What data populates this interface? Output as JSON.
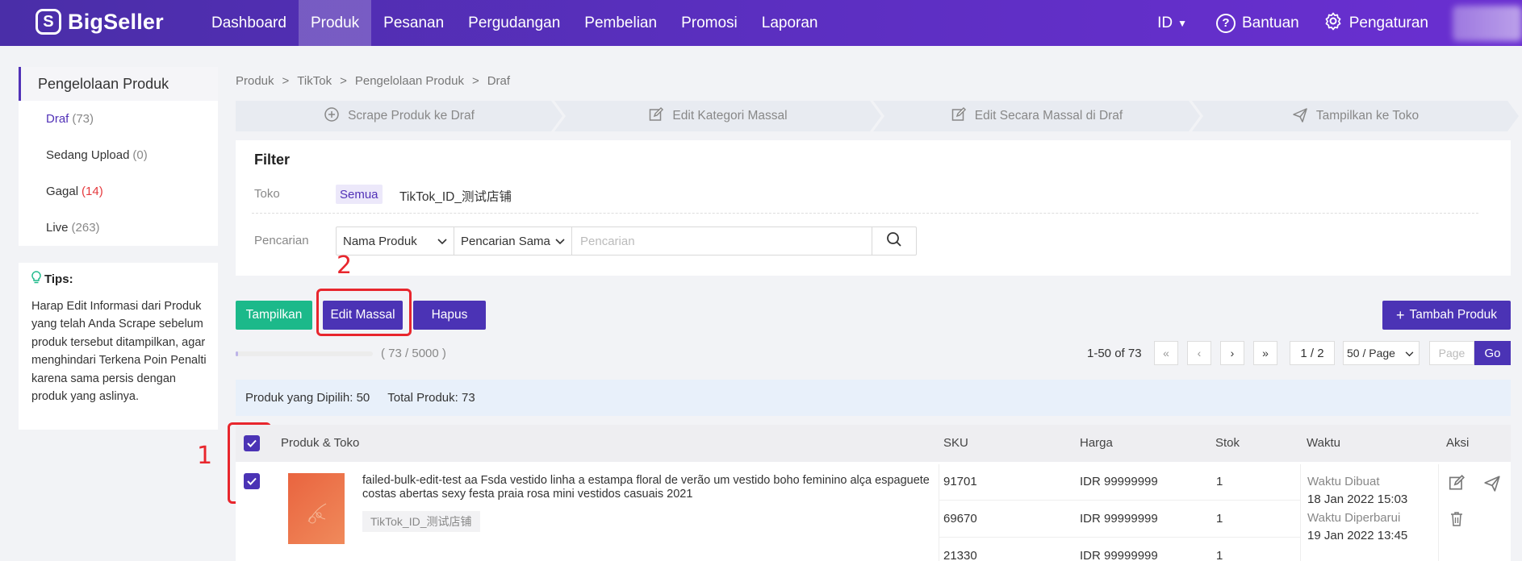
{
  "brand": {
    "name": "BigSeller"
  },
  "nav": {
    "items": [
      {
        "label": "Dashboard"
      },
      {
        "label": "Produk",
        "active": true
      },
      {
        "label": "Pesanan"
      },
      {
        "label": "Pergudangan"
      },
      {
        "label": "Pembelian"
      },
      {
        "label": "Promosi"
      },
      {
        "label": "Laporan"
      }
    ],
    "lang": "ID",
    "help": "Bantuan",
    "settings": "Pengaturan"
  },
  "sidebar": {
    "title": "Pengelolaan Produk",
    "items": [
      {
        "label": "Draf",
        "count": "(73)"
      },
      {
        "label": "Sedang Upload",
        "count": "(0)"
      },
      {
        "label": "Gagal",
        "count": "(14)"
      },
      {
        "label": "Live",
        "count": "(263)"
      }
    ]
  },
  "tips": {
    "title": "Tips:",
    "text": "Harap Edit Informasi dari Produk yang telah Anda Scrape sebelum produk tersebut ditampilkan, agar menghindari Terkena Poin Penalti karena sama persis dengan produk yang aslinya."
  },
  "breadcrumb": [
    "Produk",
    ">",
    "TikTok",
    ">",
    "Pengelolaan Produk",
    ">",
    "Draf"
  ],
  "steps": [
    {
      "label": "Scrape Produk ke Draf",
      "icon": "plus-circle-icon"
    },
    {
      "label": "Edit Kategori Massal",
      "icon": "edit-icon"
    },
    {
      "label": "Edit Secara Massal di Draf",
      "icon": "edit-icon"
    },
    {
      "label": "Tampilkan ke Toko",
      "icon": "send-icon"
    }
  ],
  "filter": {
    "title": "Filter",
    "store_label": "Toko",
    "store_all": "Semua",
    "store_option": "TikTok_ID_测试店铺",
    "search_label": "Pencarian",
    "field_select": "Nama Produk",
    "mode_select": "Pencarian Sama",
    "search_placeholder": "Pencarian"
  },
  "actions": {
    "show": "Tampilkan",
    "bulk_edit": "Edit Massal",
    "delete": "Hapus",
    "add": "Tambah Produk",
    "add_prefix": "+"
  },
  "annotations": {
    "one": "1",
    "two": "2"
  },
  "progress": {
    "text": "( 73 / 5000 )",
    "fraction": 0.0146
  },
  "pagination": {
    "info": "1-50 of 73",
    "current": "1 / 2",
    "page_size": "50 / Page",
    "page_placeholder": "Page",
    "go": "Go"
  },
  "selection": {
    "selected": "Produk yang Dipilih: 50",
    "total": "Total Produk: 73"
  },
  "table": {
    "headers": [
      "Produk & Toko",
      "SKU",
      "Harga",
      "Stok",
      "Waktu",
      "Aksi"
    ],
    "row": {
      "name": "failed-bulk-edit-test aa Fsda vestido linha a estampa floral de verão um vestido boho feminino alça espaguete costas abertas sexy festa praia rosa mini vestidos casuais 2021",
      "store": "TikTok_ID_测试店铺",
      "skus": [
        {
          "sku": "91701",
          "price": "IDR 99999999",
          "stock": "1"
        },
        {
          "sku": "69670",
          "price": "IDR 99999999",
          "stock": "1"
        },
        {
          "sku": "21330",
          "price": "IDR 99999999",
          "stock": "1"
        }
      ],
      "created_label": "Waktu Dibuat",
      "created_value": "18 Jan 2022 15:03",
      "updated_label": "Waktu Diperbarui",
      "updated_value": "19 Jan 2022 13:45"
    }
  },
  "colors": {
    "brand": "#5131b7",
    "green": "#1cb98a",
    "annotation": "#e8262d"
  }
}
